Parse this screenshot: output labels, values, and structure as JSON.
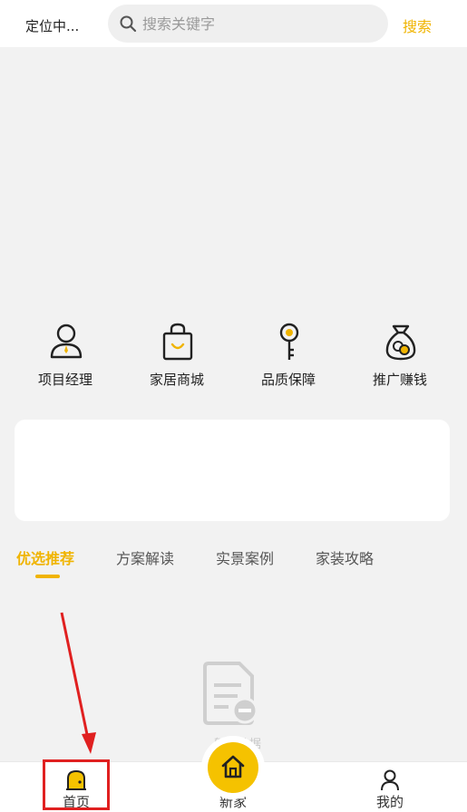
{
  "header": {
    "location": "定位中...",
    "search_placeholder": "搜索关键字",
    "search_button": "搜索"
  },
  "features": [
    {
      "label": "项目经理",
      "icon": "project-manager-icon"
    },
    {
      "label": "家居商城",
      "icon": "shopping-bag-icon"
    },
    {
      "label": "品质保障",
      "icon": "key-icon"
    },
    {
      "label": "推广赚钱",
      "icon": "money-bag-icon"
    }
  ],
  "tabs": [
    {
      "label": "优选推荐",
      "active": true
    },
    {
      "label": "方案解读",
      "active": false
    },
    {
      "label": "实景案例",
      "active": false
    },
    {
      "label": "家装攻略",
      "active": false
    }
  ],
  "empty_state": {
    "icon": "empty-document-icon",
    "text": "暂无数据"
  },
  "bottom_nav": [
    {
      "label": "首页",
      "icon": "home-icon",
      "active": true
    },
    {
      "label": "新家",
      "icon": "house-icon",
      "active": false
    },
    {
      "label": "我的",
      "icon": "user-icon",
      "active": false
    }
  ],
  "colors": {
    "accent": "#f0b400",
    "background": "#f2f2f2",
    "annotation": "#e02020"
  }
}
